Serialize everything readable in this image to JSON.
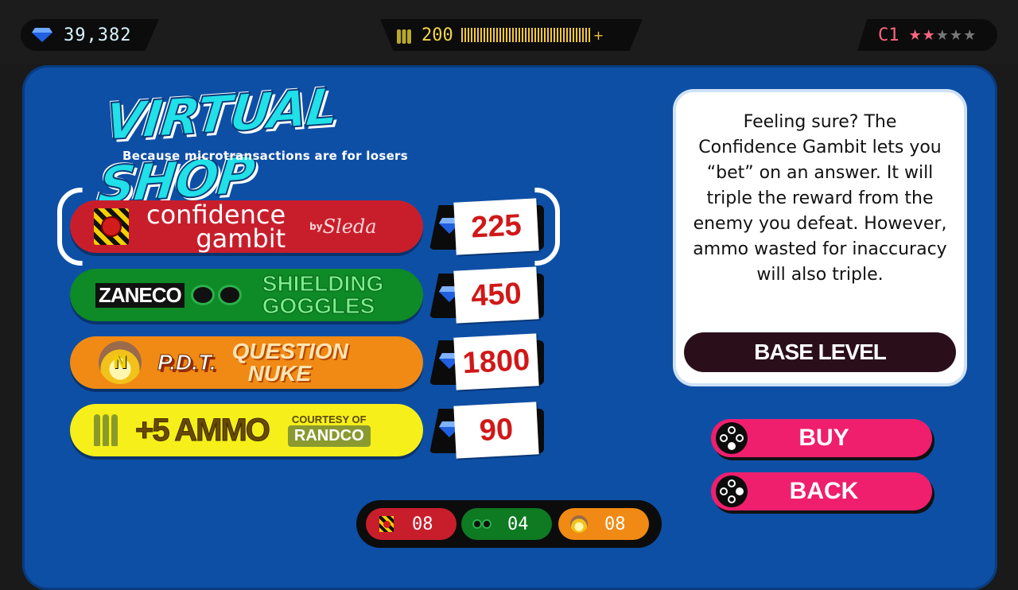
{
  "hud": {
    "gems": "39,382",
    "ammo": "200",
    "ammo_plus": "+",
    "rank": "C1",
    "stars_filled": 2,
    "stars_total": 5
  },
  "shop": {
    "title": "VIRTUAL SHOP",
    "subtitle": "Because microtransactions are for losers",
    "items": [
      {
        "name_line1": "confidence",
        "name_line2": "gambit",
        "by": "by",
        "by_name": "Sleda",
        "price": "225"
      },
      {
        "brand": "ZANECO",
        "name_line1": "SHIELDING",
        "name_line2": "GOGGLES",
        "price": "450"
      },
      {
        "brand": "P.D.T.",
        "icon_letter": "N",
        "name_line1": "QUESTION",
        "name_line2": "NUKE",
        "price": "1800"
      },
      {
        "name": "+5 AMMO",
        "courtesy": "COURTESY OF",
        "courtesy_brand": "RANDCO",
        "price": "90"
      }
    ]
  },
  "description": {
    "text": "Feeling sure? The Confidence Gambit lets you “bet” on an answer. It will triple the reward from the enemy you defeat. However, ammo wasted for inaccuracy will also triple.",
    "level_label": "BASE LEVEL"
  },
  "actions": {
    "buy": "BUY",
    "back": "BACK"
  },
  "inventory": [
    {
      "item": "confidence-gambit",
      "count": "08"
    },
    {
      "item": "shielding-goggles",
      "count": "04"
    },
    {
      "item": "question-nuke",
      "count": "08"
    }
  ],
  "colors": {
    "panel": "#0e4fa6",
    "gambit": "#c81e2c",
    "goggles": "#0e8a26",
    "nuke": "#f08a14",
    "ammo": "#f6ef1a",
    "action": "#ef1f6d",
    "title": "#20e0e8"
  },
  "icons": [
    "gem-icon",
    "bullets-icon",
    "star-icon",
    "controller-button-icon",
    "alarm-button-icon",
    "goggles-icon",
    "nuke-icon"
  ]
}
